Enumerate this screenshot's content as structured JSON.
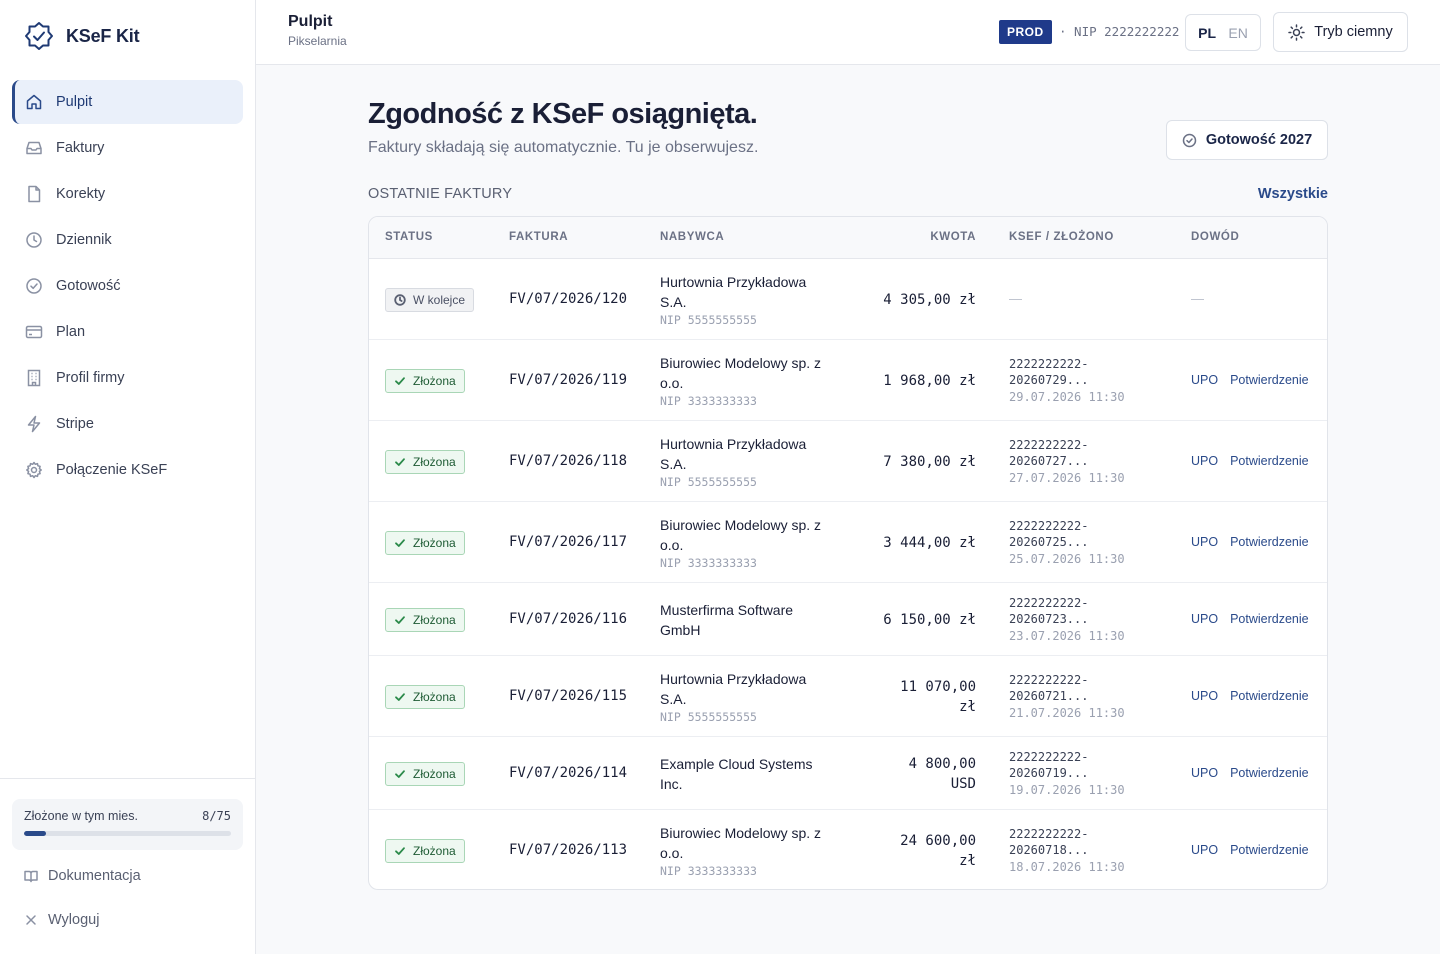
{
  "brand": {
    "name": "KSeF Kit"
  },
  "nav": [
    {
      "label": "Pulpit",
      "icon": "home-icon",
      "active": true
    },
    {
      "label": "Faktury",
      "icon": "inbox-icon"
    },
    {
      "label": "Korekty",
      "icon": "file-icon"
    },
    {
      "label": "Dziennik",
      "icon": "clock-icon"
    },
    {
      "label": "Gotowość",
      "icon": "check-circle-icon"
    },
    {
      "label": "Plan",
      "icon": "credit-card-icon"
    },
    {
      "label": "Profil firmy",
      "icon": "building-icon"
    },
    {
      "label": "Stripe",
      "icon": "bolt-icon"
    },
    {
      "label": "Połączenie KSeF",
      "icon": "gear-icon"
    }
  ],
  "usage": {
    "label": "Złożone w tym mies.",
    "count": "8/75",
    "fraction": 0.107
  },
  "footer": {
    "docs": "Dokumentacja",
    "logout": "Wyloguj"
  },
  "header": {
    "title": "Pulpit",
    "subtitle": "Pikselarnia",
    "env": "PROD",
    "nip": "· NIP 2222222222",
    "lang_pl": "PL",
    "lang_en": "EN",
    "theme": "Tryb ciemny"
  },
  "main": {
    "headline": "Zgodność z KSeF osiągnięta.",
    "subline": "Faktury składają się automatycznie. Tu je obserwujesz.",
    "ready_button": "Gotowość 2027",
    "section_title": "OSTATNIE FAKTURY",
    "all_link": "Wszystkie"
  },
  "table": {
    "columns": [
      "STATUS",
      "FAKTURA",
      "NABYWCA",
      "KWOTA",
      "KSEF / ZŁOŻONO",
      "DOWÓD"
    ],
    "rows": [
      {
        "status": "W kolejce",
        "state": "queued",
        "invoice": "FV/07/2026/120",
        "buyer_l1": "Hurtownia Przykładowa",
        "buyer_l2": "S.A.",
        "buyer_nip": "NIP 5555555555",
        "amount_l1": "4 305,00 zł",
        "amount_l2": "",
        "ksef_l1": "—",
        "ksef_l2": "",
        "ksef_date": "",
        "upo": "",
        "confirm": "",
        "proof_dash": "—"
      },
      {
        "status": "Złożona",
        "state": "filed",
        "invoice": "FV/07/2026/119",
        "buyer_l1": "Biurowiec Modelowy sp. z",
        "buyer_l2": "o.o.",
        "buyer_nip": "NIP 3333333333",
        "amount_l1": "1 968,00 zł",
        "amount_l2": "",
        "ksef_l1": "2222222222-",
        "ksef_l2": "20260729...",
        "ksef_date": "29.07.2026 11:30",
        "upo": "UPO",
        "confirm": "Potwierdzenie"
      },
      {
        "status": "Złożona",
        "state": "filed",
        "invoice": "FV/07/2026/118",
        "buyer_l1": "Hurtownia Przykładowa",
        "buyer_l2": "S.A.",
        "buyer_nip": "NIP 5555555555",
        "amount_l1": "7 380,00 zł",
        "amount_l2": "",
        "ksef_l1": "2222222222-",
        "ksef_l2": "20260727...",
        "ksef_date": "27.07.2026 11:30",
        "upo": "UPO",
        "confirm": "Potwierdzenie"
      },
      {
        "status": "Złożona",
        "state": "filed",
        "invoice": "FV/07/2026/117",
        "buyer_l1": "Biurowiec Modelowy sp. z",
        "buyer_l2": "o.o.",
        "buyer_nip": "NIP 3333333333",
        "amount_l1": "3 444,00 zł",
        "amount_l2": "",
        "ksef_l1": "2222222222-",
        "ksef_l2": "20260725...",
        "ksef_date": "25.07.2026 11:30",
        "upo": "UPO",
        "confirm": "Potwierdzenie"
      },
      {
        "status": "Złożona",
        "state": "filed",
        "invoice": "FV/07/2026/116",
        "buyer_l1": "Musterfirma Software",
        "buyer_l2": "GmbH",
        "buyer_nip": "",
        "amount_l1": "6 150,00 zł",
        "amount_l2": "",
        "ksef_l1": "2222222222-",
        "ksef_l2": "20260723...",
        "ksef_date": "23.07.2026 11:30",
        "upo": "UPO",
        "confirm": "Potwierdzenie"
      },
      {
        "status": "Złożona",
        "state": "filed",
        "invoice": "FV/07/2026/115",
        "buyer_l1": "Hurtownia Przykładowa",
        "buyer_l2": "S.A.",
        "buyer_nip": "NIP 5555555555",
        "amount_l1": "11 070,00",
        "amount_l2": "zł",
        "ksef_l1": "2222222222-",
        "ksef_l2": "20260721...",
        "ksef_date": "21.07.2026 11:30",
        "upo": "UPO",
        "confirm": "Potwierdzenie"
      },
      {
        "status": "Złożona",
        "state": "filed",
        "invoice": "FV/07/2026/114",
        "buyer_l1": "Example Cloud Systems",
        "buyer_l2": "Inc.",
        "buyer_nip": "",
        "amount_l1": "4 800,00",
        "amount_l2": "USD",
        "ksef_l1": "2222222222-",
        "ksef_l2": "20260719...",
        "ksef_date": "19.07.2026 11:30",
        "upo": "UPO",
        "confirm": "Potwierdzenie"
      },
      {
        "status": "Złożona",
        "state": "filed",
        "invoice": "FV/07/2026/113",
        "buyer_l1": "Biurowiec Modelowy sp. z",
        "buyer_l2": "o.o.",
        "buyer_nip": "NIP 3333333333",
        "amount_l1": "24 600,00",
        "amount_l2": "zł",
        "ksef_l1": "2222222222-",
        "ksef_l2": "20260718...",
        "ksef_date": "18.07.2026 11:30",
        "upo": "UPO",
        "confirm": "Potwierdzenie"
      }
    ]
  },
  "colors": {
    "accent": "#2a4a8a",
    "env_badge": "#1f3a8a",
    "filed_bg": "#eef8f1",
    "filed_border": "#a9d6b6"
  }
}
